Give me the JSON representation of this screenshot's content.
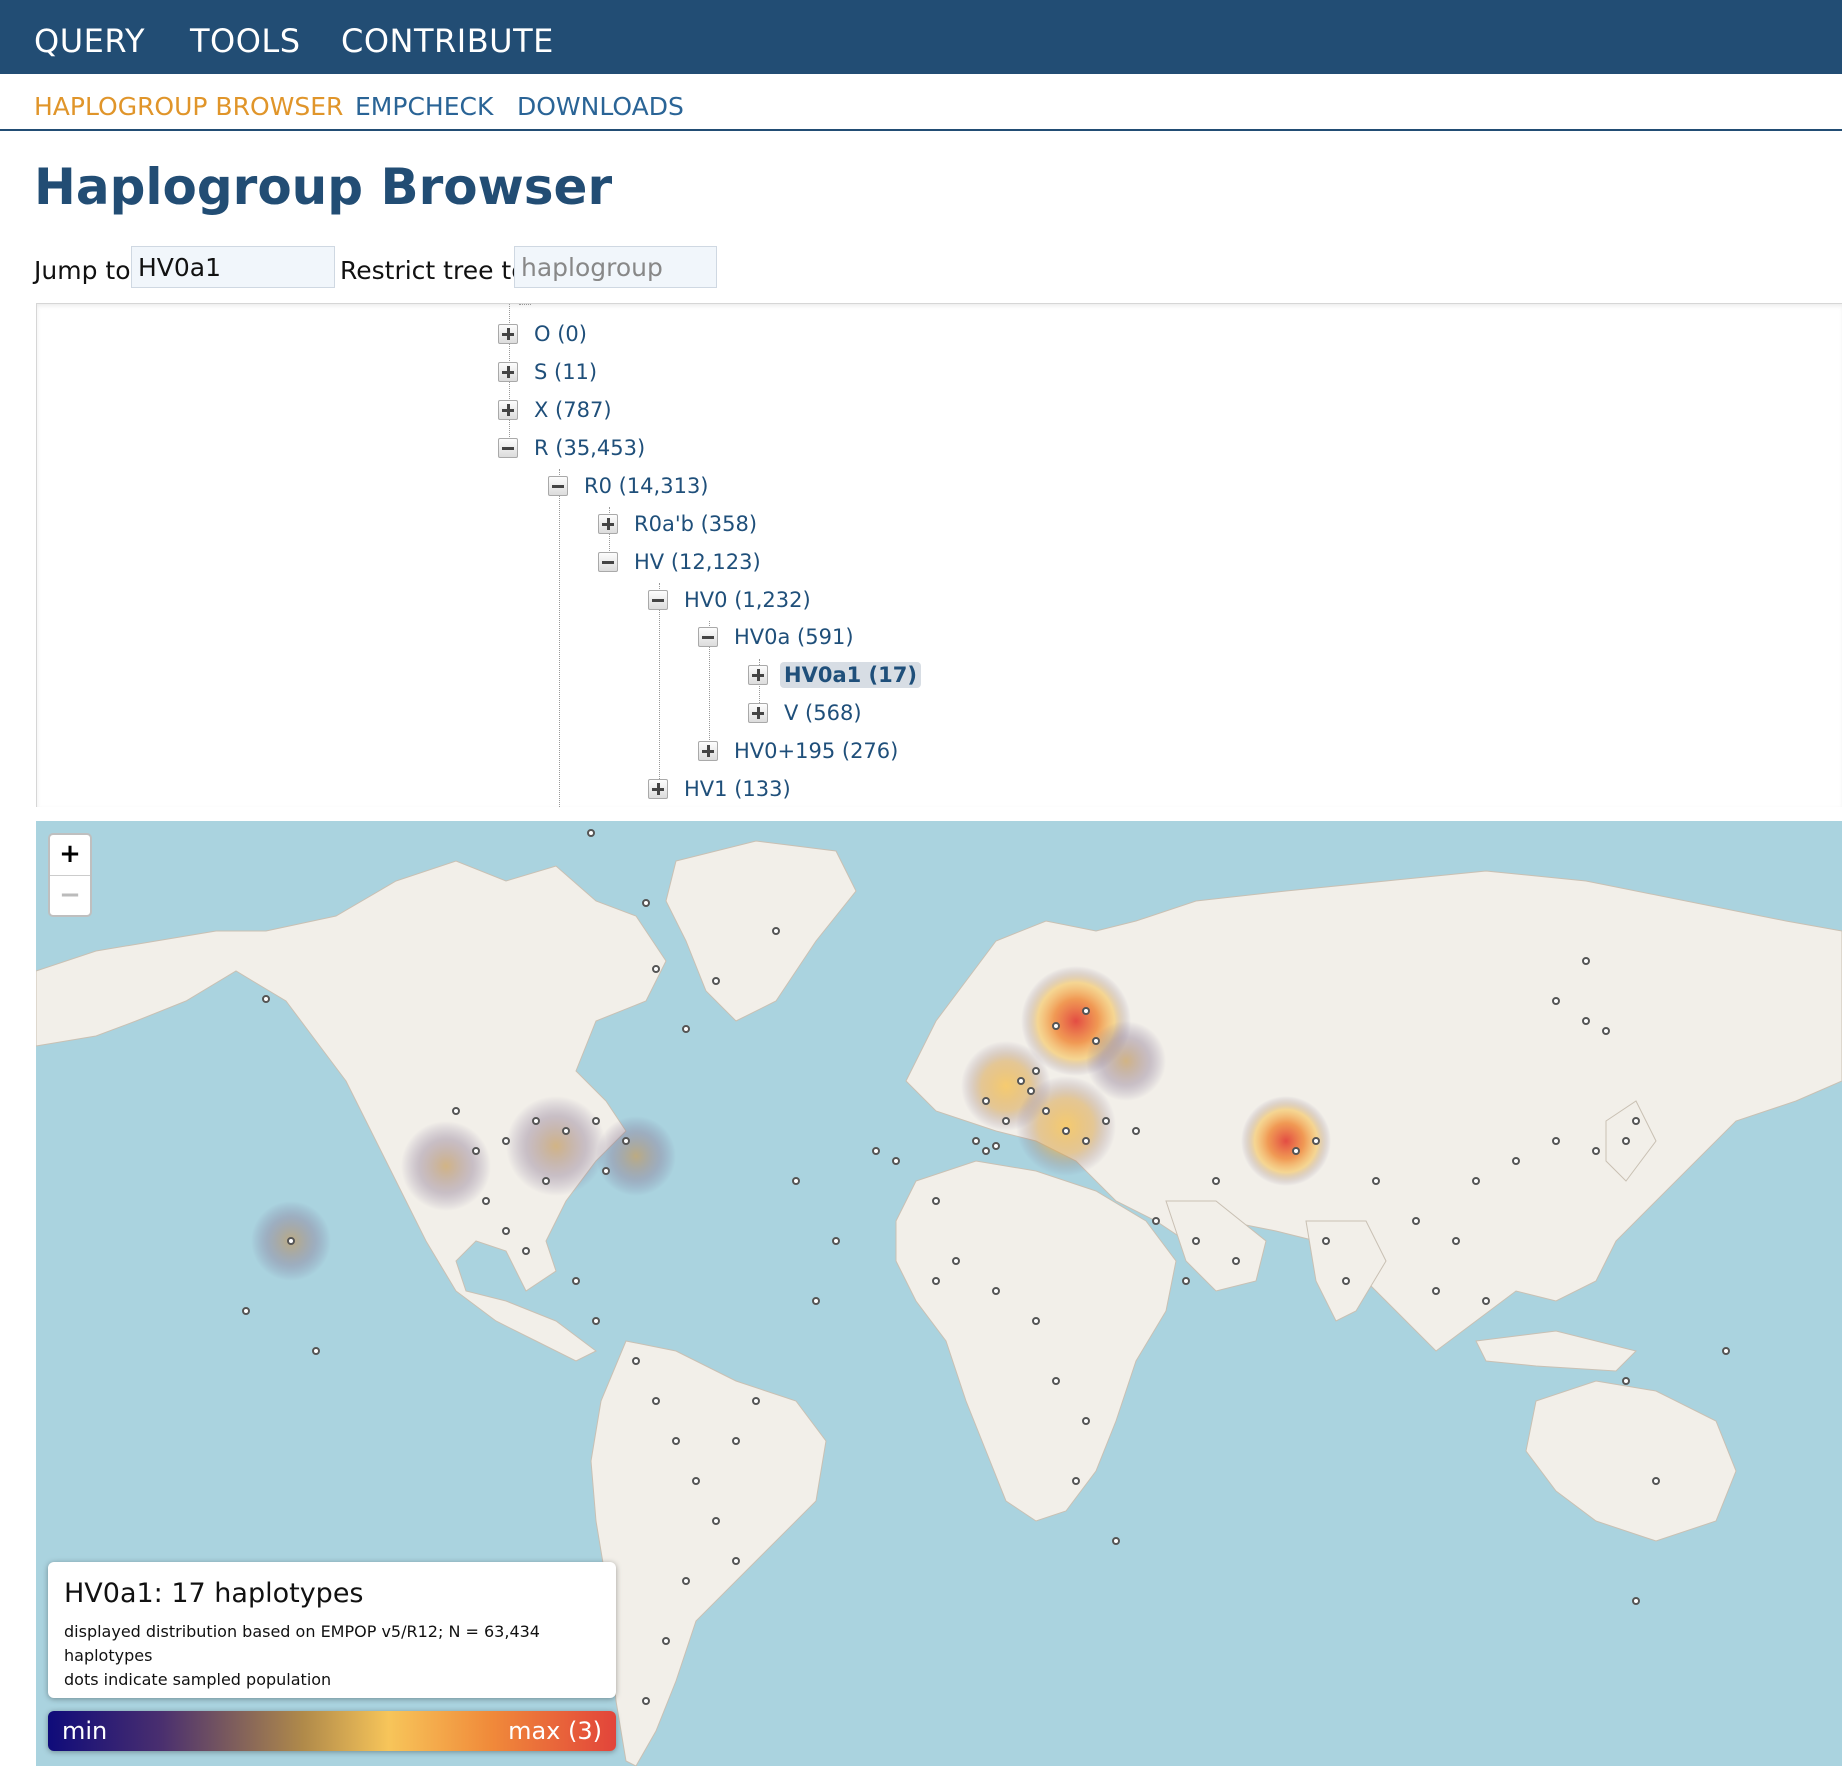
{
  "nav": {
    "items": [
      "QUERY",
      "TOOLS",
      "CONTRIBUTE"
    ]
  },
  "subnav": {
    "items": [
      "HAPLOGROUP BROWSER",
      "EMPCHECK",
      "DOWNLOADS"
    ]
  },
  "page_title": "Haplogroup Browser",
  "controls": {
    "jump_label": "Jump to",
    "jump_value": "HV0a1",
    "restrict_label": "Restrict tree to",
    "restrict_placeholder": "haplogroup"
  },
  "tree": {
    "nodes": [
      {
        "label": "O (0)",
        "toggle": "plus"
      },
      {
        "label": "S (11)",
        "toggle": "plus"
      },
      {
        "label": "X (787)",
        "toggle": "plus"
      },
      {
        "label": "R (35,453)",
        "toggle": "minus"
      },
      {
        "label": "R0 (14,313)",
        "toggle": "minus"
      },
      {
        "label": "R0a'b (358)",
        "toggle": "plus"
      },
      {
        "label": "HV (12,123)",
        "toggle": "minus"
      },
      {
        "label": "HV0 (1,232)",
        "toggle": "minus"
      },
      {
        "label": "HV0a (591)",
        "toggle": "minus"
      },
      {
        "label": "HV0a1 (17)",
        "toggle": "plus",
        "selected": true
      },
      {
        "label": "V (568)",
        "toggle": "plus"
      },
      {
        "label": "HV0+195 (276)",
        "toggle": "plus"
      },
      {
        "label": "HV1 (133)",
        "toggle": "plus"
      }
    ]
  },
  "map": {
    "zoom_in": "+",
    "zoom_out": "−",
    "colors": {
      "ocean": "#aad3df",
      "land": "#f2efe9",
      "heat_max": "#e2443a",
      "heat_mid": "#f7c55a"
    }
  },
  "legend": {
    "title": "HV0a1: 17 haplotypes",
    "line1": "displayed distribution based on EMPOP v5/R12; N = 63,434",
    "line2": "haplotypes",
    "line3": "dots indicate sampled population",
    "min_label": "min",
    "max_label": "max (3)"
  }
}
